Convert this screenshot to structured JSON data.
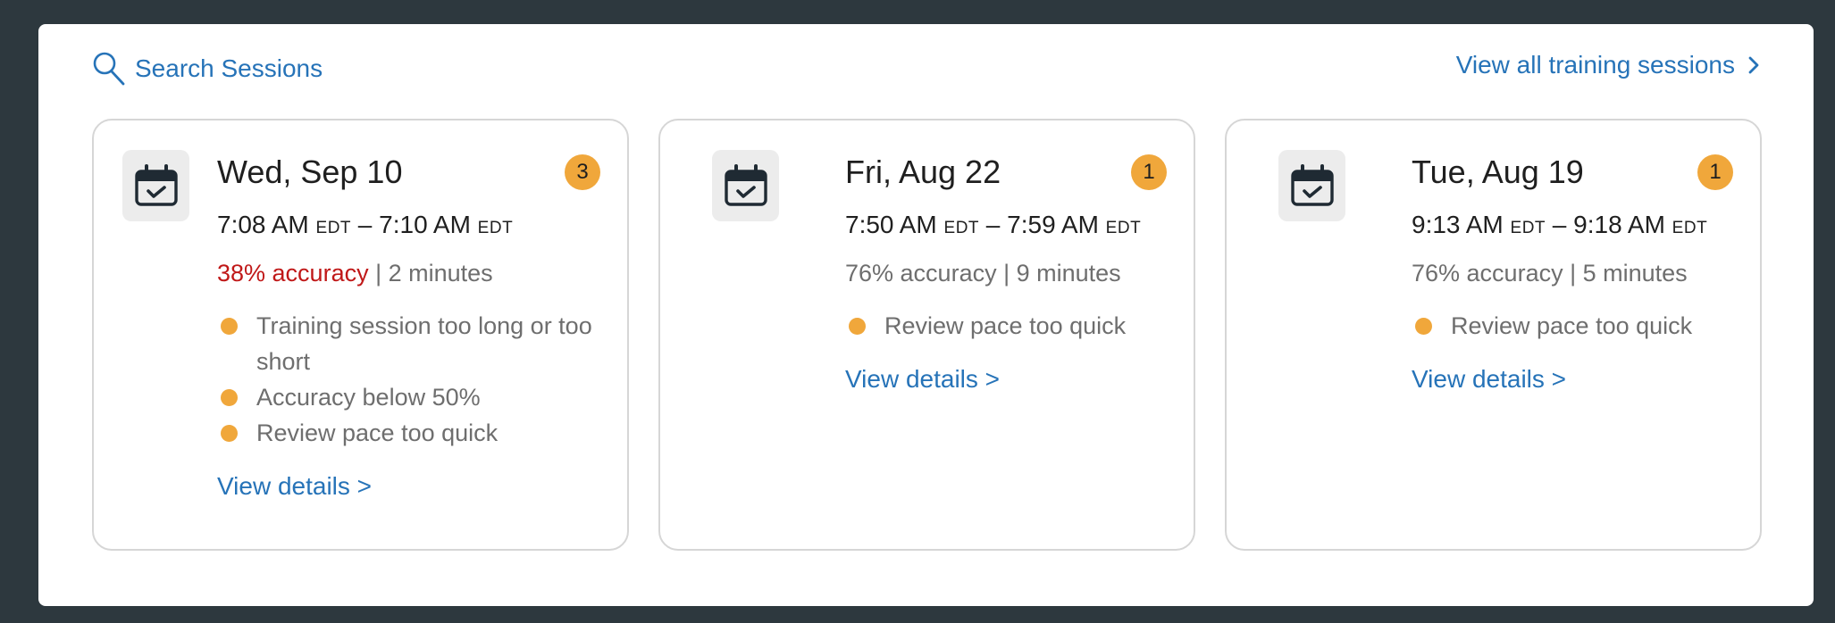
{
  "header": {
    "search_label": "Search Sessions",
    "view_all_label": "View all training sessions"
  },
  "colors": {
    "accent": "#2673b8",
    "badge": "#f0a73b",
    "danger": "#c01818",
    "backdrop": "#2d383e"
  },
  "sessions": [
    {
      "date": "Wed, Sep 10",
      "badge_count": "3",
      "start_time": "7:08 AM",
      "start_tz": "EDT",
      "separator": "–",
      "end_time": "7:10 AM",
      "end_tz": "EDT",
      "accuracy": "38% accuracy",
      "stats_sep": " | ",
      "duration": "2 minutes",
      "accuracy_flagged": true,
      "issues": [
        "Training session too long or too short",
        "Accuracy below 50%",
        "Review pace too quick"
      ],
      "details_label": "View details >",
      "icon": "calendar-check-icon"
    },
    {
      "date": "Fri, Aug 22",
      "badge_count": "1",
      "start_time": "7:50 AM",
      "start_tz": "EDT",
      "separator": "–",
      "end_time": "7:59 AM",
      "end_tz": "EDT",
      "accuracy": "76% accuracy",
      "stats_sep": " | ",
      "duration": "9 minutes",
      "accuracy_flagged": false,
      "issues": [
        "Review pace too quick"
      ],
      "details_label": "View details >",
      "icon": "calendar-check-icon"
    },
    {
      "date": "Tue, Aug 19",
      "badge_count": "1",
      "start_time": "9:13 AM",
      "start_tz": "EDT",
      "separator": "–",
      "end_time": "9:18 AM",
      "end_tz": "EDT",
      "accuracy": "76% accuracy",
      "stats_sep": " | ",
      "duration": "5 minutes",
      "accuracy_flagged": false,
      "issues": [
        "Review pace too quick"
      ],
      "details_label": "View details >",
      "icon": "calendar-check-icon"
    }
  ]
}
